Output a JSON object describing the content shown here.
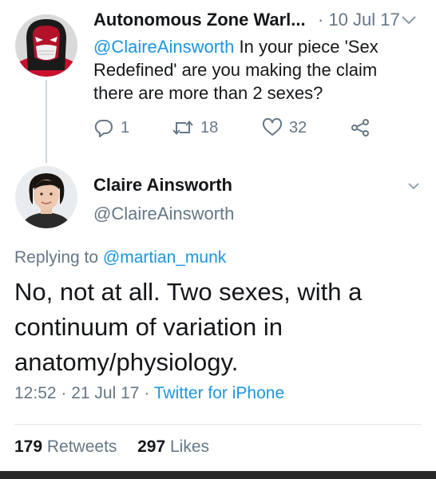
{
  "parent_tweet": {
    "display_name": "Autonomous Zone Warl...",
    "meta": "· 10 Jul 17",
    "mention": "@ClaireAinsworth",
    "text": " In your piece 'Sex Redefined' are you making the claim there are more than 2 sexes?",
    "replies": "1",
    "retweets": "18",
    "likes": "32"
  },
  "main_tweet": {
    "display_name": "Claire Ainsworth",
    "handle": "@ClaireAinsworth",
    "replying_prefix": "Replying to ",
    "replying_to": "@martian_munk",
    "text": "No, not at all. Two sexes, with a continuum of variation in anatomy/physiology.",
    "timestamp": "12:52 · 21 Jul 17 · ",
    "source": "Twitter for iPhone",
    "retweet_count": "179",
    "retweet_label": " Retweets",
    "like_count": "297",
    "like_label": " Likes"
  },
  "icons": {
    "reply": "reply-icon",
    "retweet": "retweet-icon",
    "like": "heart-icon",
    "share": "share-icon",
    "more": "chevron-down-icon"
  },
  "colors": {
    "link": "#1b95e0",
    "secondary_text": "#657786",
    "primary_text": "#14171a"
  }
}
